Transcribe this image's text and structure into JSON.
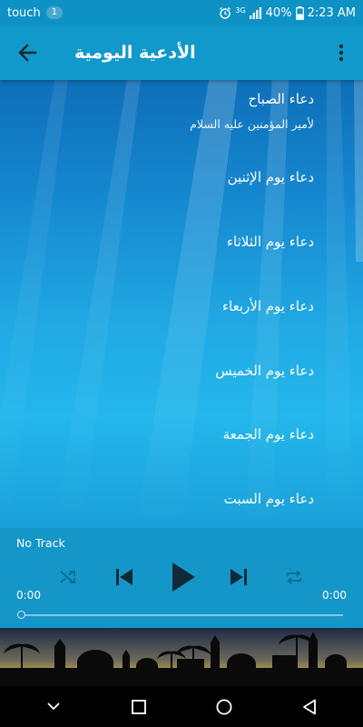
{
  "status_bar": {
    "carrier": "touch",
    "notification_count": "1",
    "network_type": "3G",
    "battery": "40%",
    "time": "2:23 AM"
  },
  "app_bar": {
    "title": "الأدعية اليومية",
    "back_icon": "arrow-back-icon",
    "menu_icon": "more-vert-icon"
  },
  "list": {
    "items": [
      {
        "title": "دعاء الصباح",
        "subtitle": "لأمير المؤمنين عليه السلام"
      },
      {
        "title": "دعاء يوم الإثنين"
      },
      {
        "title": "دعاء يوم الثلاثاء"
      },
      {
        "title": "دعاء يوم الأربعاء"
      },
      {
        "title": "دعاء يوم الخميس"
      },
      {
        "title": "دعاء يوم الجمعة"
      },
      {
        "title": "دعاء يوم السبت"
      }
    ]
  },
  "player": {
    "track_name": "No Track",
    "elapsed": "0:00",
    "duration": "0:00",
    "progress": 0,
    "controls": [
      "shuffle-icon",
      "skip-previous-icon",
      "play-icon",
      "skip-next-icon",
      "repeat-icon"
    ]
  },
  "nav_bar": {
    "buttons": [
      "chevron-down-icon",
      "recent-apps-icon",
      "home-icon",
      "back-triangle-icon"
    ]
  },
  "colors": {
    "primary": "#1199cc",
    "status_bar": "#0e92c6",
    "player": "#1596c9",
    "text": "#ffffff"
  }
}
